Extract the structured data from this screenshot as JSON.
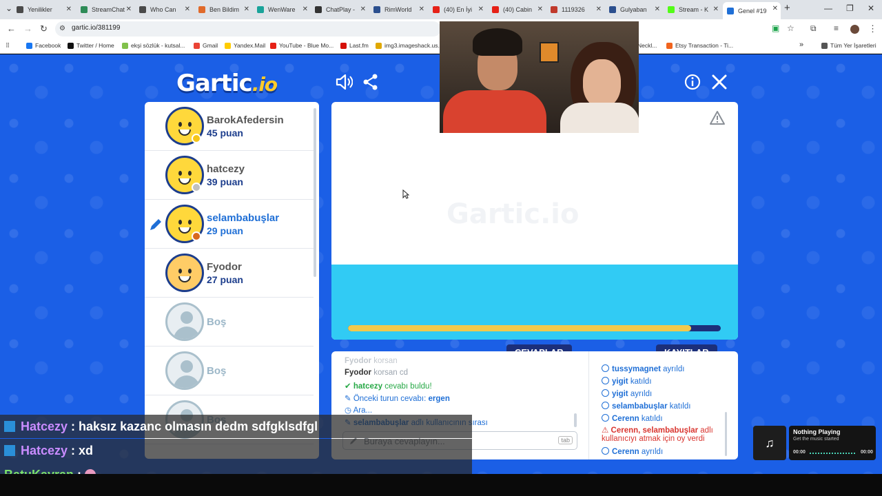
{
  "browser": {
    "tabs": [
      {
        "label": "Yenilikler",
        "color": "#4a4a4a"
      },
      {
        "label": "StreamChat",
        "color": "#2e8b57"
      },
      {
        "label": "Who Can",
        "color": "#4a4a4a"
      },
      {
        "label": "Ben Bildim",
        "color": "#e06a2b"
      },
      {
        "label": "WenWare",
        "color": "#1aa39a"
      },
      {
        "label": "ChatPlay -",
        "color": "#333333"
      },
      {
        "label": "RimWorld",
        "color": "#2b4f8e"
      },
      {
        "label": "(40) En İyi",
        "color": "#e62117"
      },
      {
        "label": "(40) Cabin",
        "color": "#e62117"
      },
      {
        "label": "1119326",
        "color": "#c0392b"
      },
      {
        "label": "Gulyaban",
        "color": "#2b4f8e"
      },
      {
        "label": "Stream - K",
        "color": "#53fc18"
      },
      {
        "label": "Genel #19",
        "color": "#1f6fd6"
      }
    ],
    "url": "gartic.io/381199",
    "bookmarks": [
      {
        "label": "Facebook",
        "color": "#1877f2"
      },
      {
        "label": "Twitter / Home",
        "color": "#111111"
      },
      {
        "label": "ekşi sözlük - kutsal...",
        "color": "#81c14b"
      },
      {
        "label": "Gmail",
        "color": "#ea4335"
      },
      {
        "label": "Yandex.Mail",
        "color": "#ffcc00"
      },
      {
        "label": "YouTube - Blue Mo...",
        "color": "#e62117"
      },
      {
        "label": "Last.fm",
        "color": "#d51007"
      },
      {
        "label": "img3.imageshack.us...",
        "color": "#e0a800"
      },
      {
        "label": "Neckl...",
        "color": "#555555"
      },
      {
        "label": "Etsy Transaction - Ti...",
        "color": "#f1641e"
      },
      {
        "label": "Tüm Yer İşaretleri",
        "color": "#555555"
      }
    ]
  },
  "game": {
    "logo_main": "Gartic",
    "logo_suffix": ".io",
    "players": [
      {
        "name": "BarokAfedersin",
        "points": "45 puan",
        "badge_color": "#f5c518",
        "drawing": false
      },
      {
        "name": "hatcezy",
        "points": "39 puan",
        "badge_color": "#c0c0c0",
        "drawing": false
      },
      {
        "name": "selambabuşlar",
        "points": "29 puan",
        "badge_color": "#d86a1e",
        "drawing": true
      },
      {
        "name": "Fyodor",
        "points": "27 puan",
        "badge_color": "",
        "drawing": false
      }
    ],
    "empty_slot_label": "Boş",
    "canvas_watermark": "Gartic.io",
    "timer_progress": 0.92,
    "answers_tab": "CEVAPLAR",
    "logs_tab": "KAYITLAR",
    "answers": [
      {
        "user": "Fyodor",
        "text": "korsan",
        "style": "faded"
      },
      {
        "user": "Fyodor",
        "text": "korsan cd",
        "style": "normal"
      },
      {
        "user": "hatcezy",
        "text": "cevabı buldu!",
        "style": "correct"
      },
      {
        "user": "Önceki turun cevabı:",
        "text": "ergen",
        "style": "prev"
      },
      {
        "user": "Ara...",
        "text": "",
        "style": "break"
      },
      {
        "user": "selambabuşlar",
        "text": "adlı kullanıcının sırası",
        "style": "turn"
      }
    ],
    "answer_placeholder": "Buraya cevaplayın...",
    "answer_key_hint": "tab",
    "logs": [
      {
        "user": "tussymagnet",
        "text": "ayrıldı",
        "style": "info"
      },
      {
        "user": "yigit",
        "text": "katıldı",
        "style": "info"
      },
      {
        "user": "yigit",
        "text": "ayrıldı",
        "style": "info"
      },
      {
        "user": "selambabuşlar",
        "text": "katıldı",
        "style": "info"
      },
      {
        "user": "Cerenn",
        "text": "katıldı",
        "style": "info"
      },
      {
        "user": "Cerenn, selambabuşlar",
        "text": "adlı kullanıcıyı atmak için oy verdi",
        "style": "warn"
      },
      {
        "user": "Cerenn",
        "text": "ayrıldı",
        "style": "info"
      }
    ]
  },
  "stream_chat": [
    {
      "user": "Hatcezy",
      "message": "haksız kazanc olmasın dedm sdfgklsdfgl",
      "user_color": "#c98cff"
    },
    {
      "user": "Hatcezy",
      "message": "xd",
      "user_color": "#c98cff"
    },
    {
      "user": "BatuKayran",
      "message": "",
      "user_color": "#7ee36b"
    }
  ],
  "music_widget": {
    "title": "Nothing Playing",
    "subtitle": "Get the music started",
    "time_start": "00:00",
    "time_end": "00:00"
  }
}
